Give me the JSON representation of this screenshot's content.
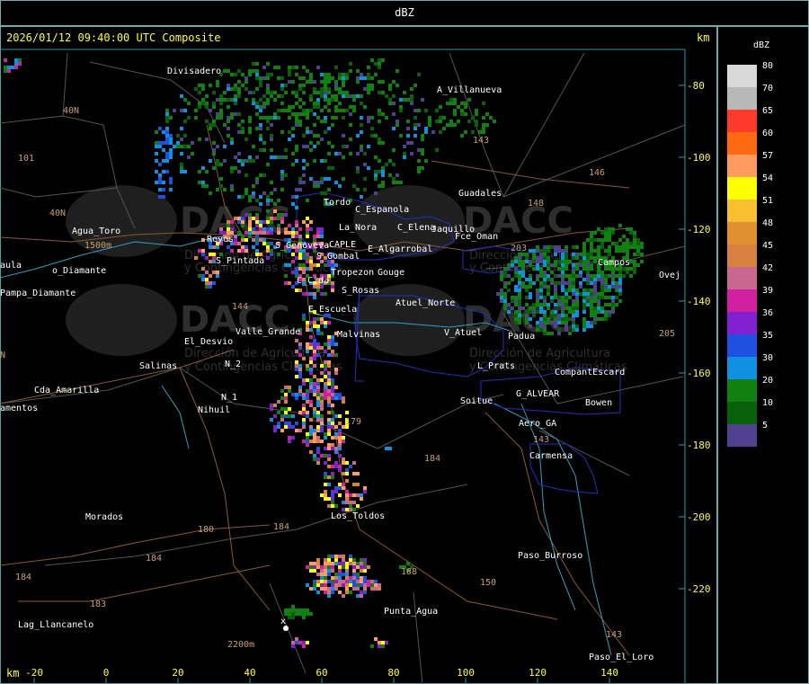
{
  "window_title": "dBZ",
  "timestamp": "2026/01/12 09:40:00 UTC Composite",
  "km_label": "km",
  "y_ticks": [
    "-80",
    "-100",
    "-120",
    "-140",
    "-160",
    "-180",
    "-200",
    "-220"
  ],
  "x_ticks": [
    "-20",
    "0",
    "20",
    "40",
    "60",
    "80",
    "100",
    "120",
    "140"
  ],
  "legend": {
    "title": "dBZ",
    "entries": [
      {
        "value": "80",
        "color": "#d8d8d8"
      },
      {
        "value": "70",
        "color": "#b8b8b8"
      },
      {
        "value": "65",
        "color": "#ff3a2a"
      },
      {
        "value": "60",
        "color": "#ff6a10"
      },
      {
        "value": "57",
        "color": "#ff9a60"
      },
      {
        "value": "54",
        "color": "#ffff00"
      },
      {
        "value": "51",
        "color": "#f8c030"
      },
      {
        "value": "48",
        "color": "#e09030"
      },
      {
        "value": "45",
        "color": "#d88040"
      },
      {
        "value": "42",
        "color": "#c86890"
      },
      {
        "value": "39",
        "color": "#d020a0"
      },
      {
        "value": "36",
        "color": "#8020d0"
      },
      {
        "value": "35",
        "color": "#2050e0"
      },
      {
        "value": "30",
        "color": "#1090e0"
      },
      {
        "value": "20",
        "color": "#108010"
      },
      {
        "value": "10",
        "color": "#086008"
      },
      {
        "value": "5",
        "color": "#504090"
      }
    ]
  },
  "watermark": {
    "logo": "DACC",
    "line1": "Dirección de Agricultura",
    "line2": "y Contingencias Climáticas",
    "url": "http://www.contingencias.mendoza.gov.ar"
  },
  "places": [
    "Divisadero",
    "A_Villanueva",
    "Guadales",
    "La_Nora",
    "C_Espanola",
    "C_Elena",
    "Jaquillo",
    "Fce_Oman",
    "Agua_Toro",
    "Pampa_Diamante",
    "Reyes",
    "S_Pintada",
    "S_Gombal",
    "E_Algarrobal",
    "Tropezon",
    "Gouge",
    "C_Cida",
    "S_Rosas",
    "Atuel_Norte",
    "El_Desvio",
    "Valle_Grande",
    "Malvinas",
    "V_Atuel",
    "Padua",
    "Campos",
    "Salinas",
    "Cda_Amarilla",
    "N_1",
    "N_2",
    "Nihuil",
    "Soitue",
    "Pratt",
    "G_ALVEAR",
    "CompantEscard",
    "Bowen",
    "Aero_GA",
    "Carmensa",
    "Morados",
    "Los_Toldos",
    "Paso_Burroso",
    "Punta_Agua",
    "Lag_Llancanelo",
    "Paso_El_Loro",
    "Oveje",
    "aula",
    "amentos"
  ],
  "roads": [
    "40N",
    "101",
    "40N",
    "143",
    "146",
    "148",
    "203",
    "144",
    "179",
    "184",
    "180",
    "184",
    "183",
    "150",
    "188",
    "143",
    "205",
    "1500m",
    "2200m",
    "N"
  ],
  "echo_colors": {
    "green": "#108010",
    "dark_green": "#086008",
    "blue": "#1090e0",
    "royal": "#2050e0",
    "purple": "#8020d0",
    "magenta": "#d020a0",
    "pink": "#c86890",
    "orange": "#d88040",
    "yellow": "#ffff00",
    "salmon": "#ff9a60",
    "violet": "#504090"
  }
}
